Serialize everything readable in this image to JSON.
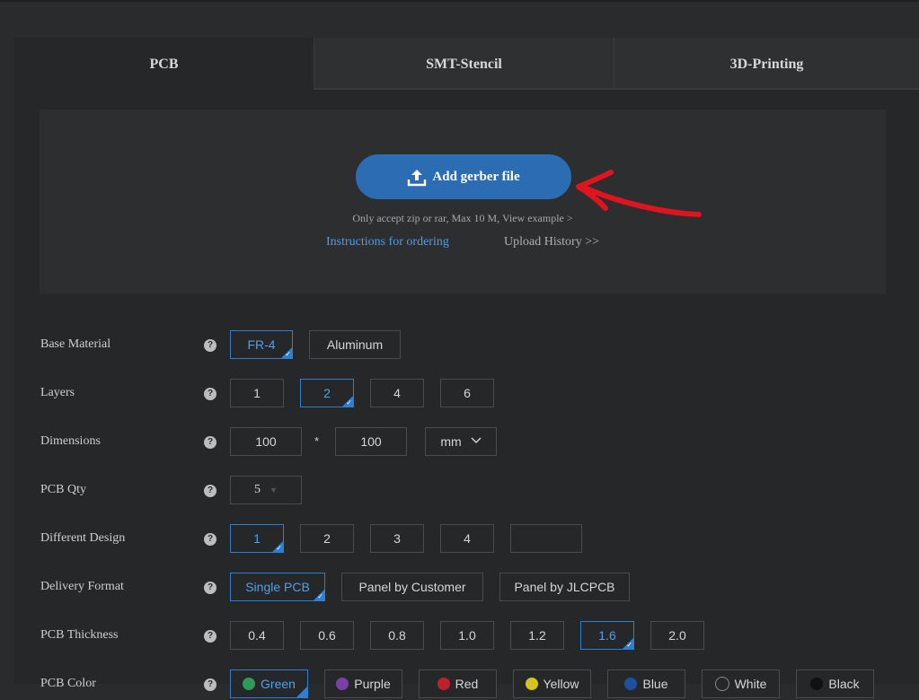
{
  "tabs": [
    {
      "label": "PCB"
    },
    {
      "label": "SMT-Stencil"
    },
    {
      "label": "3D-Printing"
    }
  ],
  "upload": {
    "button_label": "Add gerber file",
    "accept_note": "Only accept zip or rar, Max 10 M, View example >",
    "instructions_link": "Instructions for ordering",
    "history_link": "Upload History >>"
  },
  "form": {
    "base_material": {
      "label": "Base Material",
      "options": [
        "FR-4",
        "Aluminum"
      ],
      "selected": "FR-4"
    },
    "layers": {
      "label": "Layers",
      "options": [
        "1",
        "2",
        "4",
        "6"
      ],
      "selected": "2"
    },
    "dimensions": {
      "label": "Dimensions",
      "width": "100",
      "sep": "*",
      "height": "100",
      "unit": "mm"
    },
    "pcb_qty": {
      "label": "PCB Qty",
      "value": "5"
    },
    "different_design": {
      "label": "Different Design",
      "options": [
        "1",
        "2",
        "3",
        "4",
        ""
      ],
      "selected": "1"
    },
    "delivery_format": {
      "label": "Delivery Format",
      "options": [
        "Single PCB",
        "Panel by Customer",
        "Panel by JLCPCB"
      ],
      "selected": "Single PCB"
    },
    "pcb_thickness": {
      "label": "PCB Thickness",
      "options": [
        "0.4",
        "0.6",
        "0.8",
        "1.0",
        "1.2",
        "1.6",
        "2.0"
      ],
      "selected": "1.6"
    },
    "pcb_color": {
      "label": "PCB Color",
      "options": [
        {
          "label": "Green",
          "color": "#2e9a5a"
        },
        {
          "label": "Purple",
          "color": "#7b3fa8"
        },
        {
          "label": "Red",
          "color": "#c0202a"
        },
        {
          "label": "Yellow",
          "color": "#d4c420"
        },
        {
          "label": "Blue",
          "color": "#1e4fa0"
        },
        {
          "label": "White",
          "color": "#f0f0f0"
        },
        {
          "label": "Black",
          "color": "#111111"
        }
      ],
      "selected": "Green"
    }
  },
  "colors": {
    "accent": "#2b6cb3",
    "selected_border": "#2d7fd6",
    "annotation_arrow": "#e0141e"
  }
}
